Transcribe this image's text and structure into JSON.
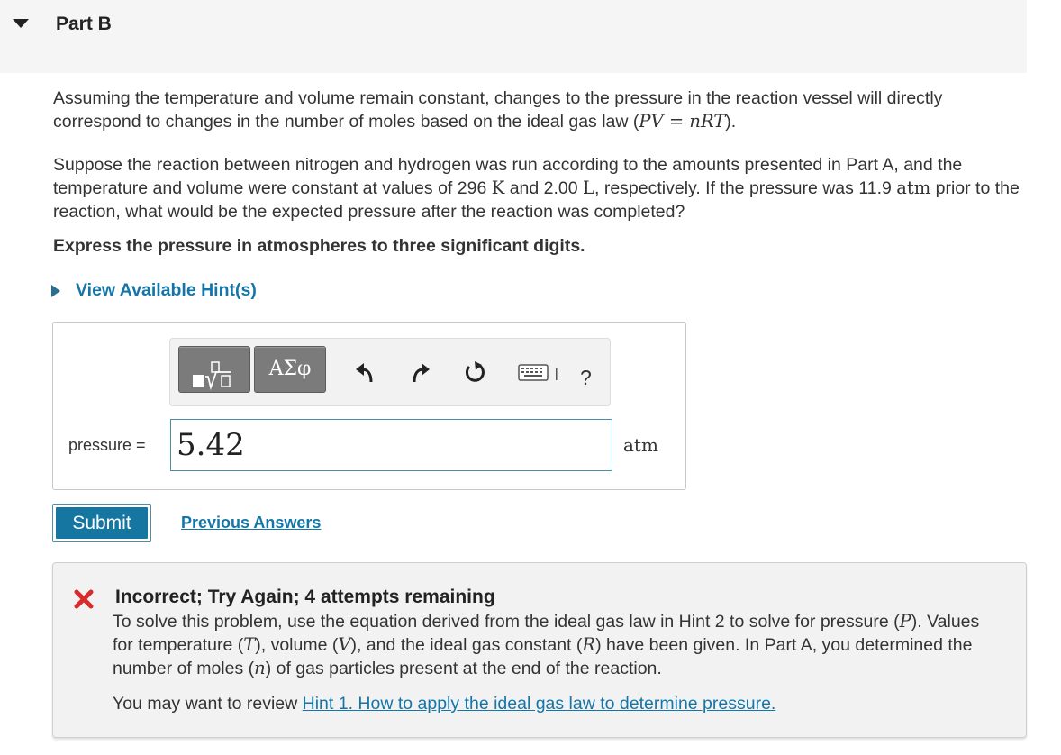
{
  "part": {
    "title": "Part B"
  },
  "problem": {
    "p1": {
      "text": "Assuming the temperature and volume remain constant, changes to the pressure in the reaction vessel will directly correspond to changes in the number of moles based on the ideal gas law (",
      "eq_p": "P",
      "eq_v": "V",
      "eq_equals": " = ",
      "eq_n": "n",
      "eq_r": "R",
      "eq_t": "T",
      "end": ")."
    },
    "p2": {
      "a": "Suppose the reaction between nitrogen and hydrogen was run according to the amounts presented in Part A, and the temperature and volume were constant at values of 296 ",
      "k": "K",
      "b": " and 2.00 ",
      "l": "L",
      "c": ", respectively. If the pressure was 11.9 ",
      "atm": "atm",
      "d": " prior to the reaction, what would be the expected pressure after the reaction was completed?"
    },
    "instruction": "Express the pressure in atmospheres to three significant digits."
  },
  "hints": {
    "toggle_label": "View Available Hint(s)"
  },
  "toolbar": {
    "greek_label": "ΑΣφ",
    "help_label": "?",
    "icons": [
      "templates-icon",
      "greek-letters-icon",
      "undo-icon",
      "redo-icon",
      "reset-icon",
      "keyboard-icon",
      "help-icon"
    ]
  },
  "answer": {
    "label": "pressure =",
    "value": "5.42",
    "unit": "atm"
  },
  "actions": {
    "submit_label": "Submit",
    "previous_answers_label": "Previous Answers"
  },
  "feedback": {
    "title": "Incorrect; Try Again; 4 attempts remaining",
    "s1": "To solve this problem, use the equation derived from the ideal gas law in Hint 2 to solve for pressure (",
    "p": "P",
    "s2": "). Values for temperature (",
    "t": "T",
    "s3": "), volume (",
    "v": "V",
    "s4": "), and the ideal gas constant (",
    "r": "R",
    "s5": ") have been given. In Part A, you determined the number of moles (",
    "n": "n",
    "s6": ") of gas particles present at the end of the reaction.",
    "review_prefix": "You may want to review ",
    "hint_link": "Hint 1. How to apply the ideal gas law to determine pressure."
  },
  "colors": {
    "link": "#1476a8",
    "submit": "#1676a2",
    "error": "#d92b2b",
    "header_bg": "#f5f5f5",
    "feedback_bg": "#f2f2f2"
  }
}
